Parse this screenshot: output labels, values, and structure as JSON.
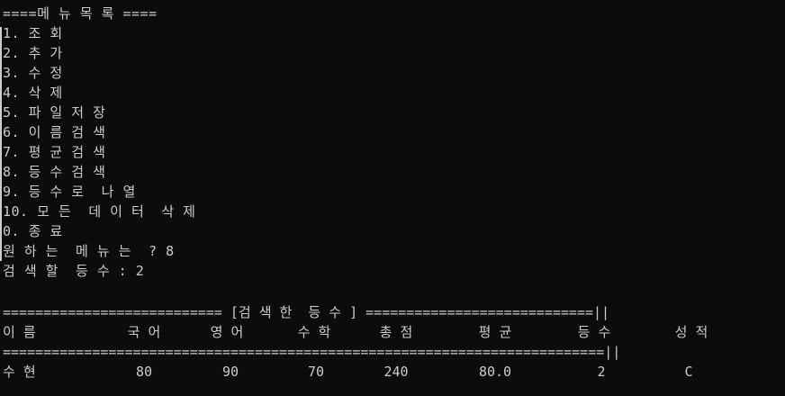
{
  "console": {
    "menu_header": "====메 뉴 목 록 ====",
    "menu_items": [
      "1. 조 회",
      "2. 추 가",
      "3. 수 정",
      "4. 삭 제",
      "5. 파 일 저 장",
      "6. 이 름 검 색",
      "7. 평 균 검 색",
      "8. 등 수 검 색",
      "9. 등 수 로  나 열",
      "10. 모 든  데 이 터  삭 제",
      "0. 종 료"
    ],
    "prompt_line": "원 하 는  메 뉴 는  ? 8",
    "search_prompt": "검 색 할  등 수 : 2",
    "result_title_line": "=========================== [검 색 한  등 수 ] ============================||",
    "table_headers": [
      "이 름",
      "국 어",
      "영 어",
      "수 학",
      "총 점",
      "평 균",
      "등 수",
      "성 적"
    ],
    "separator_line": "==========================================================================||",
    "result_row": [
      "수 현",
      "80",
      "90",
      "70",
      "240",
      "80.0",
      "2",
      "C"
    ]
  }
}
